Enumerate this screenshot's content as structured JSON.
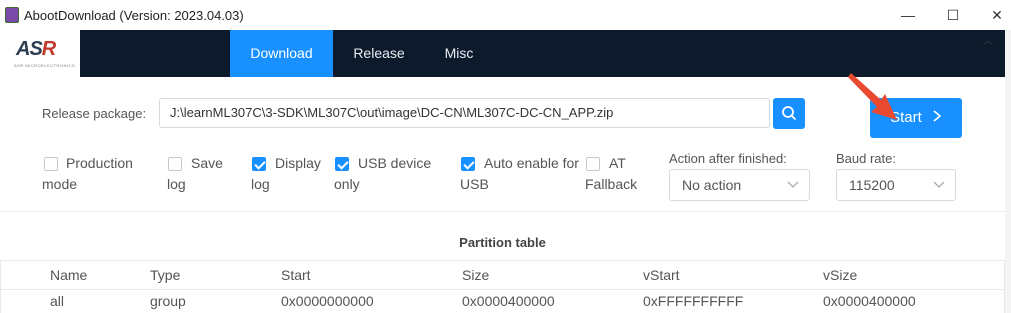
{
  "window": {
    "title": "AbootDownload (Version: 2023.04.03)",
    "controls": {
      "minimize": "—",
      "maximize": "☐",
      "close": "✕"
    },
    "collapse_glyph": "︿"
  },
  "brand": {
    "logo_text_a": "AS",
    "logo_text_b": "R",
    "logo_sub": "ASR MICROELECTRONICS"
  },
  "nav": {
    "tabs": [
      {
        "label": "Download",
        "active": true
      },
      {
        "label": "Release",
        "active": false
      },
      {
        "label": "Misc",
        "active": false
      }
    ]
  },
  "release": {
    "label": "Release package:",
    "path": "J:\\learnML307C\\3-SDK\\ML307C\\out\\image\\DC-CN\\ML307C-DC-CN_APP.zip"
  },
  "start_button": {
    "label": "Start",
    "glyph": "〉"
  },
  "options": [
    {
      "line1": "Production",
      "line2": "mode",
      "checked": false
    },
    {
      "line1": "Save",
      "line2": "log",
      "checked": false
    },
    {
      "line1": "Display",
      "line2": "log",
      "checked": true
    },
    {
      "line1": "USB device",
      "line2": "only",
      "checked": true
    },
    {
      "line1": "Auto enable for",
      "line2": "USB",
      "checked": true
    },
    {
      "line1": "AT",
      "line2": "Fallback",
      "checked": false
    }
  ],
  "action_after": {
    "label": "Action after finished:",
    "value": "No action"
  },
  "baud": {
    "label": "Baud rate:",
    "value": "115200"
  },
  "partition": {
    "title": "Partition table",
    "columns": [
      "Name",
      "Type",
      "Start",
      "Size",
      "vStart",
      "vSize"
    ],
    "rows": [
      [
        "all",
        "group",
        "0x0000000000",
        "0x0000400000",
        "0xFFFFFFFFFF",
        "0x0000400000"
      ]
    ]
  },
  "colors": {
    "accent": "#1890ff",
    "nav_bg": "#0d1a2b",
    "annotation_arrow": "#e8492f"
  },
  "icons": [
    "app-icon",
    "search-icon",
    "chevron-right-icon",
    "chevron-down-icon",
    "checkbox-icon",
    "red-arrow-annotation"
  ]
}
